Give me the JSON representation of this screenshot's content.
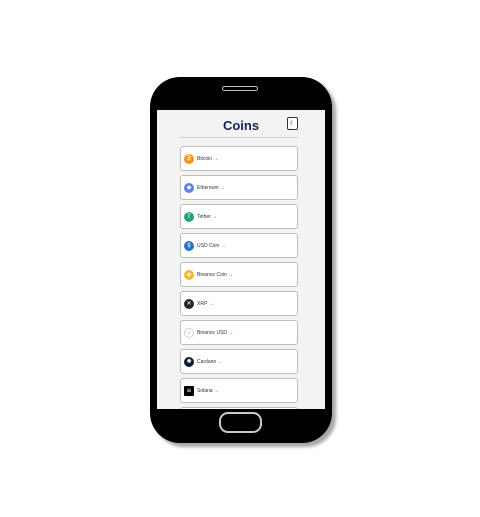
{
  "header": {
    "title": "Coins",
    "theme_toggle_icon": "moon-icon"
  },
  "coins": [
    {
      "label": "Bitcoin →",
      "icon": "bitcoin-icon",
      "glyph": "₿",
      "color": "#f7931a"
    },
    {
      "label": "Ethereum →",
      "icon": "ethereum-icon",
      "glyph": "◆",
      "color": "#627eea"
    },
    {
      "label": "Tether →",
      "icon": "tether-icon",
      "glyph": "T",
      "color": "#26a17b"
    },
    {
      "label": "USD Coin →",
      "icon": "usd-coin-icon",
      "glyph": "$",
      "color": "#2775ca"
    },
    {
      "label": "Binance Coin →",
      "icon": "binance-coin-icon",
      "glyph": "◈",
      "color": "#f3ba2f"
    },
    {
      "label": "XRP →",
      "icon": "xrp-icon",
      "glyph": "✕",
      "color": "#23292f"
    },
    {
      "label": "Binance USD →",
      "icon": "binance-usd-icon",
      "glyph": "◇",
      "color": "#cfcfcf"
    },
    {
      "label": "Cardano →",
      "icon": "cardano-icon",
      "glyph": "✺",
      "color": "#0d1e30"
    },
    {
      "label": "Solana →",
      "icon": "solana-icon",
      "glyph": "≡",
      "color": "#000000"
    }
  ]
}
